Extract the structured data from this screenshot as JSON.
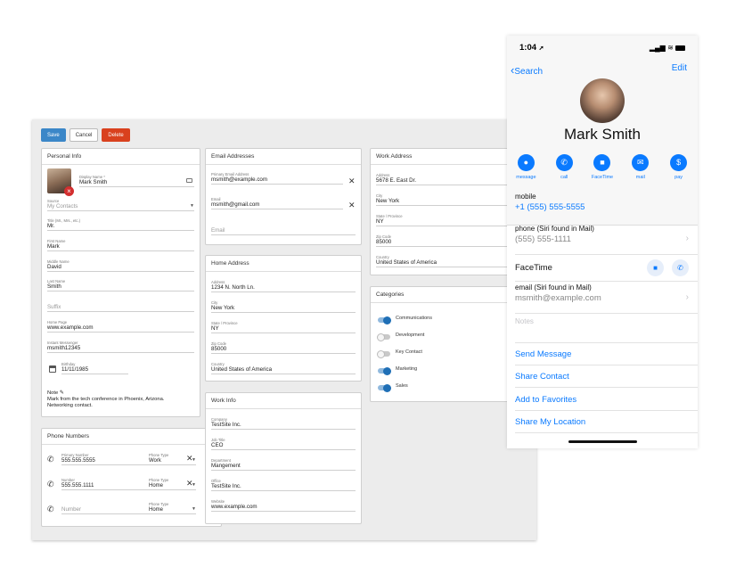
{
  "toolbar": {
    "save_label": "Save",
    "cancel_label": "Cancel",
    "delete_label": "Delete"
  },
  "personal_info": {
    "title": "Personal Info",
    "display_name_label": "Display Name *",
    "display_name": "Mark Smith",
    "source_label": "Source",
    "source_value": "My Contacts",
    "title_field_label": "Title (Mr., Mrs., etc.)",
    "title_value": "Mr.",
    "first_name_label": "First Name",
    "first_name": "Mark",
    "middle_name_label": "Middle Name",
    "middle_name": "David",
    "last_name_label": "Last Name",
    "last_name": "Smith",
    "suffix_placeholder": "Suffix",
    "home_page_label": "Home Page",
    "home_page": "www.example.com",
    "im_label": "Instant Messenger",
    "im_value": "msmith12345",
    "birthday_label": "Birthday",
    "birthday": "11/11/1985",
    "note_label": "Note",
    "note_text": "Mark from the tech conference in Phoenix, Arizona. Networking contact."
  },
  "phone_numbers": {
    "title": "Phone Numbers",
    "rows": [
      {
        "label": "Primary Number",
        "number": "555.555.5555",
        "type_label": "Phone Type",
        "type": "Work"
      },
      {
        "label": "Number",
        "number": "555.555.1111",
        "type_label": "Phone Type",
        "type": "Home"
      },
      {
        "label": "",
        "number": "Number",
        "type_label": "Phone Type",
        "type": "Home"
      }
    ]
  },
  "email_addresses": {
    "title": "Email Addresses",
    "primary_label": "Primary Email Address",
    "primary": "msmith@example.com",
    "email_label": "Email",
    "email": "msmith@gmail.com",
    "empty_placeholder": "Email"
  },
  "home_address": {
    "title": "Home Address",
    "address_label": "Address",
    "address": "1234 N. North Ln.",
    "city_label": "City",
    "city": "New York",
    "state_label": "State / Province",
    "state": "NY",
    "zip_label": "Zip Code",
    "zip": "85000",
    "country_label": "Country",
    "country": "United States of America"
  },
  "work_info": {
    "title": "Work Info",
    "company_label": "Company",
    "company": "TestSite Inc.",
    "job_title_label": "Job Title",
    "job_title": "CEO",
    "department_label": "Department",
    "department": "Mangement",
    "office_label": "Office",
    "office": "TestSite Inc.",
    "website_label": "Website",
    "website": "www.example.com"
  },
  "work_address": {
    "title": "Work Address",
    "address_label": "Address",
    "address": "5678 E. East Dr.",
    "city_label": "City",
    "city": "New York",
    "state_label": "State / Province",
    "state": "NY",
    "zip_label": "Zip Code",
    "zip": "85000",
    "country_label": "Country",
    "country": "United States of America"
  },
  "categories": {
    "title": "Categories",
    "items": [
      {
        "label": "Communications",
        "on": true
      },
      {
        "label": "Development",
        "on": false
      },
      {
        "label": "Key Contact",
        "on": false
      },
      {
        "label": "Marketing",
        "on": true
      },
      {
        "label": "Sales",
        "on": true
      }
    ]
  },
  "ios": {
    "time": "1:04",
    "back_label": "Search",
    "edit_label": "Edit",
    "name": "Mark Smith",
    "actions": [
      {
        "label": "message",
        "icon": "message-icon"
      },
      {
        "label": "call",
        "icon": "phone-icon"
      },
      {
        "label": "FaceTime",
        "icon": "video-icon"
      },
      {
        "label": "mail",
        "icon": "mail-icon"
      },
      {
        "label": "pay",
        "icon": "dollar-icon"
      }
    ],
    "mobile_label": "mobile",
    "mobile_value": "+1 (555) 555-5555",
    "siri_phone_label": "phone (Siri found in Mail)",
    "siri_phone_value": "(555) 555-1111",
    "facetime_label": "FaceTime",
    "siri_email_label": "email (Siri found in Mail)",
    "siri_email_value": "msmith@example.com",
    "notes_placeholder": "Notes",
    "links": [
      "Send Message",
      "Share Contact",
      "Add to Favorites",
      "Share My Location"
    ]
  },
  "colors": {
    "primary": "#3b87c8",
    "danger": "#d9411e",
    "ios_blue": "#0a7aff"
  }
}
